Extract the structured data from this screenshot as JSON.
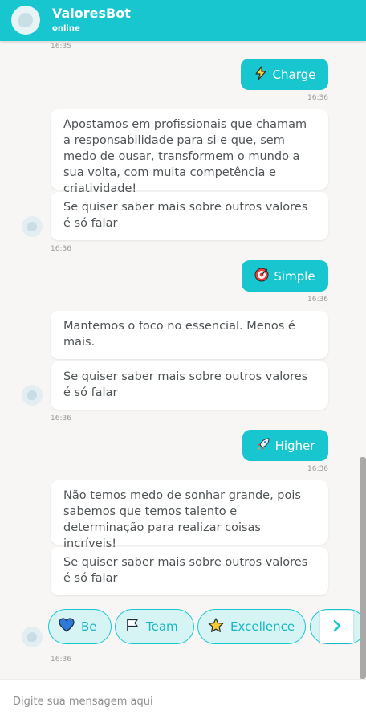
{
  "header": {
    "bot_name": "ValoresBot",
    "status": "online"
  },
  "messages": {
    "t0": "16:35",
    "user1": {
      "label": "Charge",
      "icon": "lightning-icon",
      "time": "16:36"
    },
    "bot1": {
      "text1": "Apostamos em profissionais que chamam a responsabilidade para si e que, sem medo de ousar, transformem o mundo a sua volta, com muita competência e criatividade!",
      "text2": "Se quiser saber mais sobre outros valores é só falar",
      "time": "16:36"
    },
    "user2": {
      "label": "Simple",
      "icon": "target-icon",
      "time": "16:36"
    },
    "bot2": {
      "text1": "Mantemos o foco no essencial. Menos é mais.",
      "text2": "Se quiser saber mais sobre outros valores é só falar",
      "time": "16:36"
    },
    "user3": {
      "label": "Higher",
      "icon": "rocket-icon",
      "time": "16:36"
    },
    "bot3": {
      "text1": "Não temos medo de sonhar grande, pois sabemos que temos talento e determinação para realizar coisas incríveis!",
      "text2": "Se quiser saber mais sobre outros valores é só falar",
      "time": "16:36"
    }
  },
  "quick_replies": [
    {
      "label": "Be",
      "icon": "heart-icon"
    },
    {
      "label": "Team",
      "icon": "flag-icon"
    },
    {
      "label": "Excellence",
      "icon": "star-icon"
    },
    {
      "label": "",
      "icon": "more-icon"
    }
  ],
  "quick_replies_time": "16:36",
  "composer": {
    "placeholder": "Digite sua mensagem aqui"
  },
  "colors": {
    "accent": "#17c6cf",
    "background": "#f7f6f5",
    "bubble": "#ffffff"
  }
}
